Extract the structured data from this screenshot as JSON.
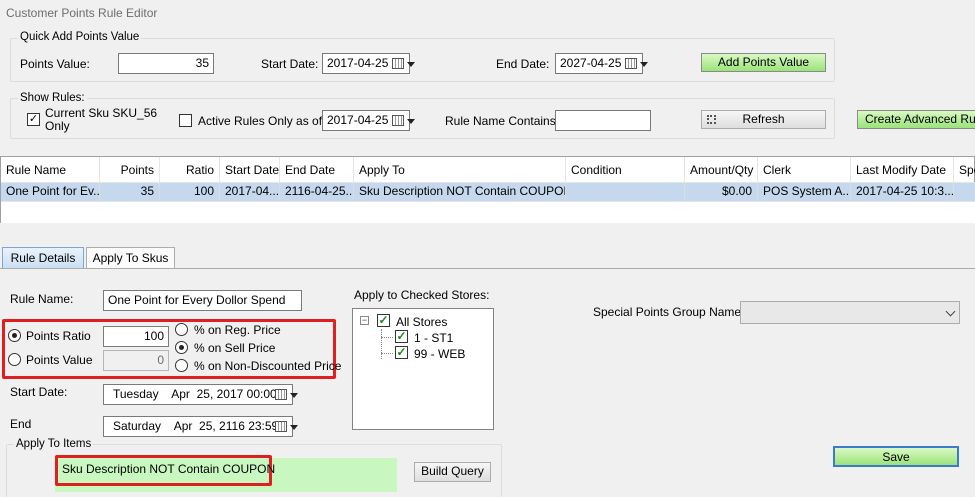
{
  "window": {
    "title": "Customer Points Rule Editor"
  },
  "quick_add": {
    "group_label": "Quick Add Points Value",
    "points_value_label": "Points Value:",
    "points_value": "35",
    "start_date_label": "Start Date:",
    "start_date": "2017-04-25",
    "end_date_label": "End Date:",
    "end_date": "2027-04-25",
    "add_button": "Add Points Value"
  },
  "show_rules": {
    "group_label": "Show Rules:",
    "current_sku_label_line1": "Current Sku SKU_56",
    "current_sku_label_line2": "Only",
    "current_sku_checked": true,
    "active_rules_label": "Active Rules Only as of",
    "active_rules_checked": false,
    "active_date": "2017-04-25",
    "rule_name_contains_label": "Rule Name Contains:",
    "rule_name_contains_value": "",
    "refresh_button": "Refresh",
    "create_advanced_button": "Create Advanced Rule"
  },
  "grid": {
    "columns": [
      "Rule Name",
      "Points",
      "Ratio",
      "Start Date",
      "End Date",
      "Apply To",
      "Condition",
      "Amount/Qty",
      "Clerk",
      "Last Modify Date",
      "Spe"
    ],
    "rows": [
      [
        "One Point for Ev...",
        "35",
        "100",
        "2017-04...",
        "2116-04-25...",
        "Sku Description NOT Contain COUPON",
        "",
        "$0.00",
        "POS System A...",
        "2017-04-25 10:3...",
        ""
      ]
    ]
  },
  "tabs": {
    "rule_details": "Rule Details",
    "apply_to_skus": "Apply To Skus"
  },
  "details": {
    "rule_name_label": "Rule Name:",
    "rule_name_value": "One Point for Every Dollor Spend",
    "points_ratio_label": "Points Ratio",
    "points_ratio_value": "100",
    "points_value_label": "Points Value",
    "points_value_value": "0",
    "mode_selected": "points_ratio",
    "price_options": [
      "% on Reg. Price",
      "% on Sell Price",
      "% on Non-Discounted Price"
    ],
    "price_selected_index": 1,
    "start_date_label": "Start Date:",
    "start_date_value": "Tuesday    Apr  25, 2017 00:00",
    "end_label": "End",
    "end_value": "Saturday    Apr  25, 2116 23:59",
    "apply_to_items_label": "Apply To Items",
    "apply_to_items_value": "Sku Description NOT Contain COUPON",
    "build_query_button": "Build Query",
    "stores_label": "Apply to Checked Stores:",
    "stores_root": "All Stores",
    "stores": [
      "1 - ST1",
      "99 - WEB"
    ],
    "tree_expander": "−",
    "check_mark": "✓",
    "special_group_label": "Special Points Group Name:",
    "special_group_value": "",
    "save_button": "Save"
  },
  "icons": {
    "calendar": "calendar-icon",
    "dropdown": "chevron-down-icon",
    "refresh": "refresh-icon"
  },
  "colors": {
    "selected_row": "#c6d8ee",
    "green_field": "#c8f7c0",
    "highlight_red": "#e02020"
  }
}
